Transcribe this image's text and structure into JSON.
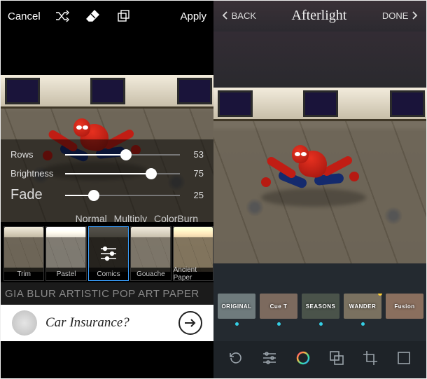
{
  "left": {
    "topbar": {
      "cancel": "Cancel",
      "apply": "Apply"
    },
    "sliders": [
      {
        "label": "Rows",
        "value": 53
      },
      {
        "label": "Brightness",
        "value": 75
      },
      {
        "label": "Fade",
        "value": 25
      }
    ],
    "blend_modes": [
      "Normal",
      "Multiply",
      "ColorBurn"
    ],
    "filters": [
      {
        "name": "Trim",
        "selected": false
      },
      {
        "name": "Pastel",
        "selected": false
      },
      {
        "name": "Comics",
        "selected": true
      },
      {
        "name": "Gouache",
        "selected": false
      },
      {
        "name": "Ancient Paper",
        "selected": false
      }
    ],
    "categories": [
      "GIA",
      "BLUR",
      "ARTISTIC",
      "POP ART",
      "PAPER"
    ],
    "ad": {
      "text": "Car Insurance?"
    }
  },
  "right": {
    "topbar": {
      "back": "BACK",
      "brand": "Afterlight",
      "done": "DONE"
    },
    "filters": [
      {
        "name": "ORIGINAL",
        "dot": true,
        "color": "#6f7b7d"
      },
      {
        "name": "Cue T",
        "dot": true,
        "color": "#7c6a5e"
      },
      {
        "name": "SEASONS",
        "dot": true,
        "color": "#4a534a"
      },
      {
        "name": "WANDER",
        "dot": true,
        "color": "#7a7160",
        "new": true
      },
      {
        "name": "Fusion",
        "dot": false,
        "color": "#8a6f5e"
      }
    ],
    "tools": [
      "revert",
      "adjust",
      "filters",
      "frames",
      "crop",
      "border"
    ]
  }
}
